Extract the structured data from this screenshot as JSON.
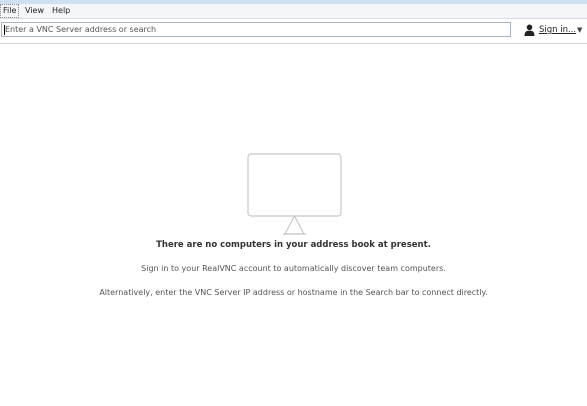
{
  "menubar": {
    "items": [
      {
        "label": "File"
      },
      {
        "label": "View"
      },
      {
        "label": "Help"
      }
    ]
  },
  "toolbar": {
    "search_placeholder": "Enter a VNC Server address or search",
    "sign_in_label": "Sign in...",
    "sign_in_icon": "user-icon",
    "dropdown_icon": "caret-down-icon"
  },
  "main": {
    "illustration_icon": "monitor-icon",
    "empty_title": "There are no computers in your address book at present.",
    "empty_line1": "Sign in to your RealVNC account to automatically discover team computers.",
    "empty_line2": "Alternatively, enter the VNC Server IP address or hostname in the Search bar to connect directly."
  },
  "colors": {
    "monitor_stroke": "#c8c8c8",
    "title_strip": "#cfe0f2"
  }
}
